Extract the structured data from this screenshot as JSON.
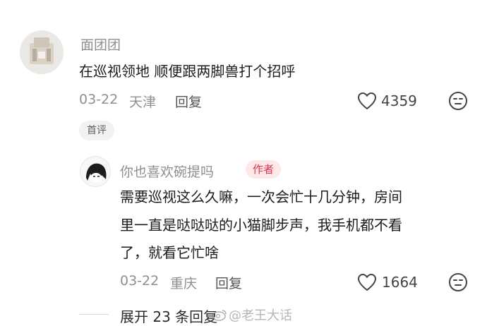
{
  "comment": {
    "username": "面团团",
    "text": "在巡视领地 顺便跟两脚兽打个招呼",
    "date": "03-22",
    "location": "天津",
    "reply_label": "回复",
    "like_count": "4359",
    "badge": "首评"
  },
  "reply": {
    "username": "你也喜欢碗提吗",
    "author_badge": "作者",
    "text_lines": [
      "需要巡视这么久嘛，一次会忙十几分钟，房间",
      "里一直是哒哒哒的小猫脚步声，我手机都不看",
      "了，就看它忙啥"
    ],
    "date": "03-22",
    "location": "重庆",
    "reply_label": "回复",
    "like_count": "1664"
  },
  "expand_label": "展开 23 条回复",
  "watermark": "@老王大话",
  "colors": {
    "author_badge_bg": "#fde8ea",
    "author_badge_text": "#e2334a",
    "meta_gray": "#8f8f8f"
  },
  "icons": [
    "heart-outline-icon",
    "dislike-face-icon",
    "weibo-icon"
  ]
}
